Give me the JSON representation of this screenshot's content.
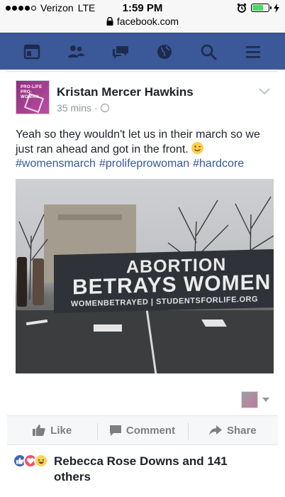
{
  "status_bar": {
    "carrier": "Verizon",
    "network": "LTE",
    "time": "1:59 PM",
    "signal_bars_filled": 4,
    "signal_bars_total": 5,
    "battery_fraction": 0.7
  },
  "url_bar": {
    "domain": "facebook.com"
  },
  "nav": {
    "items": [
      "newsfeed-icon",
      "friends-icon",
      "messages-icon",
      "notifications-globe-icon",
      "search-icon",
      "menu-icon"
    ],
    "bar_color": "#3b5998"
  },
  "post": {
    "author": "Kristan Mercer Hawkins",
    "time": "35 mins",
    "separator": "·",
    "text": "Yeah so they wouldn't let us in their march so we just ran ahead and got in the front.",
    "hashtags": [
      "#womensmarch",
      "#prolifeprowoman",
      "#hardcore"
    ],
    "hashtag_color": "#365899",
    "image": {
      "banner_line1": "ABORTION",
      "banner_line2": "BETRAYS WOMEN",
      "banner_line3": "WOMENBETRAYED | STUDENTSFORLIFE.ORG"
    },
    "avatar_text": "PRO-LIFE PRO-WOMAN"
  },
  "actions": {
    "like": "Like",
    "comment": "Comment",
    "share": "Share"
  },
  "reactions": {
    "summary": "Rebecca Rose Downs and 141 others",
    "types": [
      "like",
      "love",
      "haha"
    ]
  }
}
